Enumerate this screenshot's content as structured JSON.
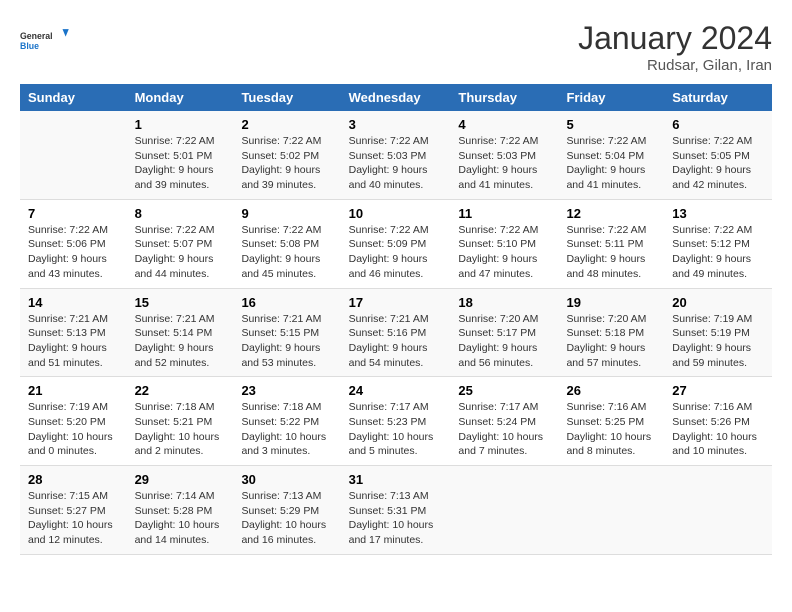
{
  "header": {
    "logo_line1": "General",
    "logo_line2": "Blue",
    "month_year": "January 2024",
    "location": "Rudsar, Gilan, Iran"
  },
  "weekdays": [
    "Sunday",
    "Monday",
    "Tuesday",
    "Wednesday",
    "Thursday",
    "Friday",
    "Saturday"
  ],
  "weeks": [
    [
      {
        "day": "",
        "info": ""
      },
      {
        "day": "1",
        "info": "Sunrise: 7:22 AM\nSunset: 5:01 PM\nDaylight: 9 hours\nand 39 minutes."
      },
      {
        "day": "2",
        "info": "Sunrise: 7:22 AM\nSunset: 5:02 PM\nDaylight: 9 hours\nand 39 minutes."
      },
      {
        "day": "3",
        "info": "Sunrise: 7:22 AM\nSunset: 5:03 PM\nDaylight: 9 hours\nand 40 minutes."
      },
      {
        "day": "4",
        "info": "Sunrise: 7:22 AM\nSunset: 5:03 PM\nDaylight: 9 hours\nand 41 minutes."
      },
      {
        "day": "5",
        "info": "Sunrise: 7:22 AM\nSunset: 5:04 PM\nDaylight: 9 hours\nand 41 minutes."
      },
      {
        "day": "6",
        "info": "Sunrise: 7:22 AM\nSunset: 5:05 PM\nDaylight: 9 hours\nand 42 minutes."
      }
    ],
    [
      {
        "day": "7",
        "info": "Sunrise: 7:22 AM\nSunset: 5:06 PM\nDaylight: 9 hours\nand 43 minutes."
      },
      {
        "day": "8",
        "info": "Sunrise: 7:22 AM\nSunset: 5:07 PM\nDaylight: 9 hours\nand 44 minutes."
      },
      {
        "day": "9",
        "info": "Sunrise: 7:22 AM\nSunset: 5:08 PM\nDaylight: 9 hours\nand 45 minutes."
      },
      {
        "day": "10",
        "info": "Sunrise: 7:22 AM\nSunset: 5:09 PM\nDaylight: 9 hours\nand 46 minutes."
      },
      {
        "day": "11",
        "info": "Sunrise: 7:22 AM\nSunset: 5:10 PM\nDaylight: 9 hours\nand 47 minutes."
      },
      {
        "day": "12",
        "info": "Sunrise: 7:22 AM\nSunset: 5:11 PM\nDaylight: 9 hours\nand 48 minutes."
      },
      {
        "day": "13",
        "info": "Sunrise: 7:22 AM\nSunset: 5:12 PM\nDaylight: 9 hours\nand 49 minutes."
      }
    ],
    [
      {
        "day": "14",
        "info": "Sunrise: 7:21 AM\nSunset: 5:13 PM\nDaylight: 9 hours\nand 51 minutes."
      },
      {
        "day": "15",
        "info": "Sunrise: 7:21 AM\nSunset: 5:14 PM\nDaylight: 9 hours\nand 52 minutes."
      },
      {
        "day": "16",
        "info": "Sunrise: 7:21 AM\nSunset: 5:15 PM\nDaylight: 9 hours\nand 53 minutes."
      },
      {
        "day": "17",
        "info": "Sunrise: 7:21 AM\nSunset: 5:16 PM\nDaylight: 9 hours\nand 54 minutes."
      },
      {
        "day": "18",
        "info": "Sunrise: 7:20 AM\nSunset: 5:17 PM\nDaylight: 9 hours\nand 56 minutes."
      },
      {
        "day": "19",
        "info": "Sunrise: 7:20 AM\nSunset: 5:18 PM\nDaylight: 9 hours\nand 57 minutes."
      },
      {
        "day": "20",
        "info": "Sunrise: 7:19 AM\nSunset: 5:19 PM\nDaylight: 9 hours\nand 59 minutes."
      }
    ],
    [
      {
        "day": "21",
        "info": "Sunrise: 7:19 AM\nSunset: 5:20 PM\nDaylight: 10 hours\nand 0 minutes."
      },
      {
        "day": "22",
        "info": "Sunrise: 7:18 AM\nSunset: 5:21 PM\nDaylight: 10 hours\nand 2 minutes."
      },
      {
        "day": "23",
        "info": "Sunrise: 7:18 AM\nSunset: 5:22 PM\nDaylight: 10 hours\nand 3 minutes."
      },
      {
        "day": "24",
        "info": "Sunrise: 7:17 AM\nSunset: 5:23 PM\nDaylight: 10 hours\nand 5 minutes."
      },
      {
        "day": "25",
        "info": "Sunrise: 7:17 AM\nSunset: 5:24 PM\nDaylight: 10 hours\nand 7 minutes."
      },
      {
        "day": "26",
        "info": "Sunrise: 7:16 AM\nSunset: 5:25 PM\nDaylight: 10 hours\nand 8 minutes."
      },
      {
        "day": "27",
        "info": "Sunrise: 7:16 AM\nSunset: 5:26 PM\nDaylight: 10 hours\nand 10 minutes."
      }
    ],
    [
      {
        "day": "28",
        "info": "Sunrise: 7:15 AM\nSunset: 5:27 PM\nDaylight: 10 hours\nand 12 minutes."
      },
      {
        "day": "29",
        "info": "Sunrise: 7:14 AM\nSunset: 5:28 PM\nDaylight: 10 hours\nand 14 minutes."
      },
      {
        "day": "30",
        "info": "Sunrise: 7:13 AM\nSunset: 5:29 PM\nDaylight: 10 hours\nand 16 minutes."
      },
      {
        "day": "31",
        "info": "Sunrise: 7:13 AM\nSunset: 5:31 PM\nDaylight: 10 hours\nand 17 minutes."
      },
      {
        "day": "",
        "info": ""
      },
      {
        "day": "",
        "info": ""
      },
      {
        "day": "",
        "info": ""
      }
    ]
  ]
}
